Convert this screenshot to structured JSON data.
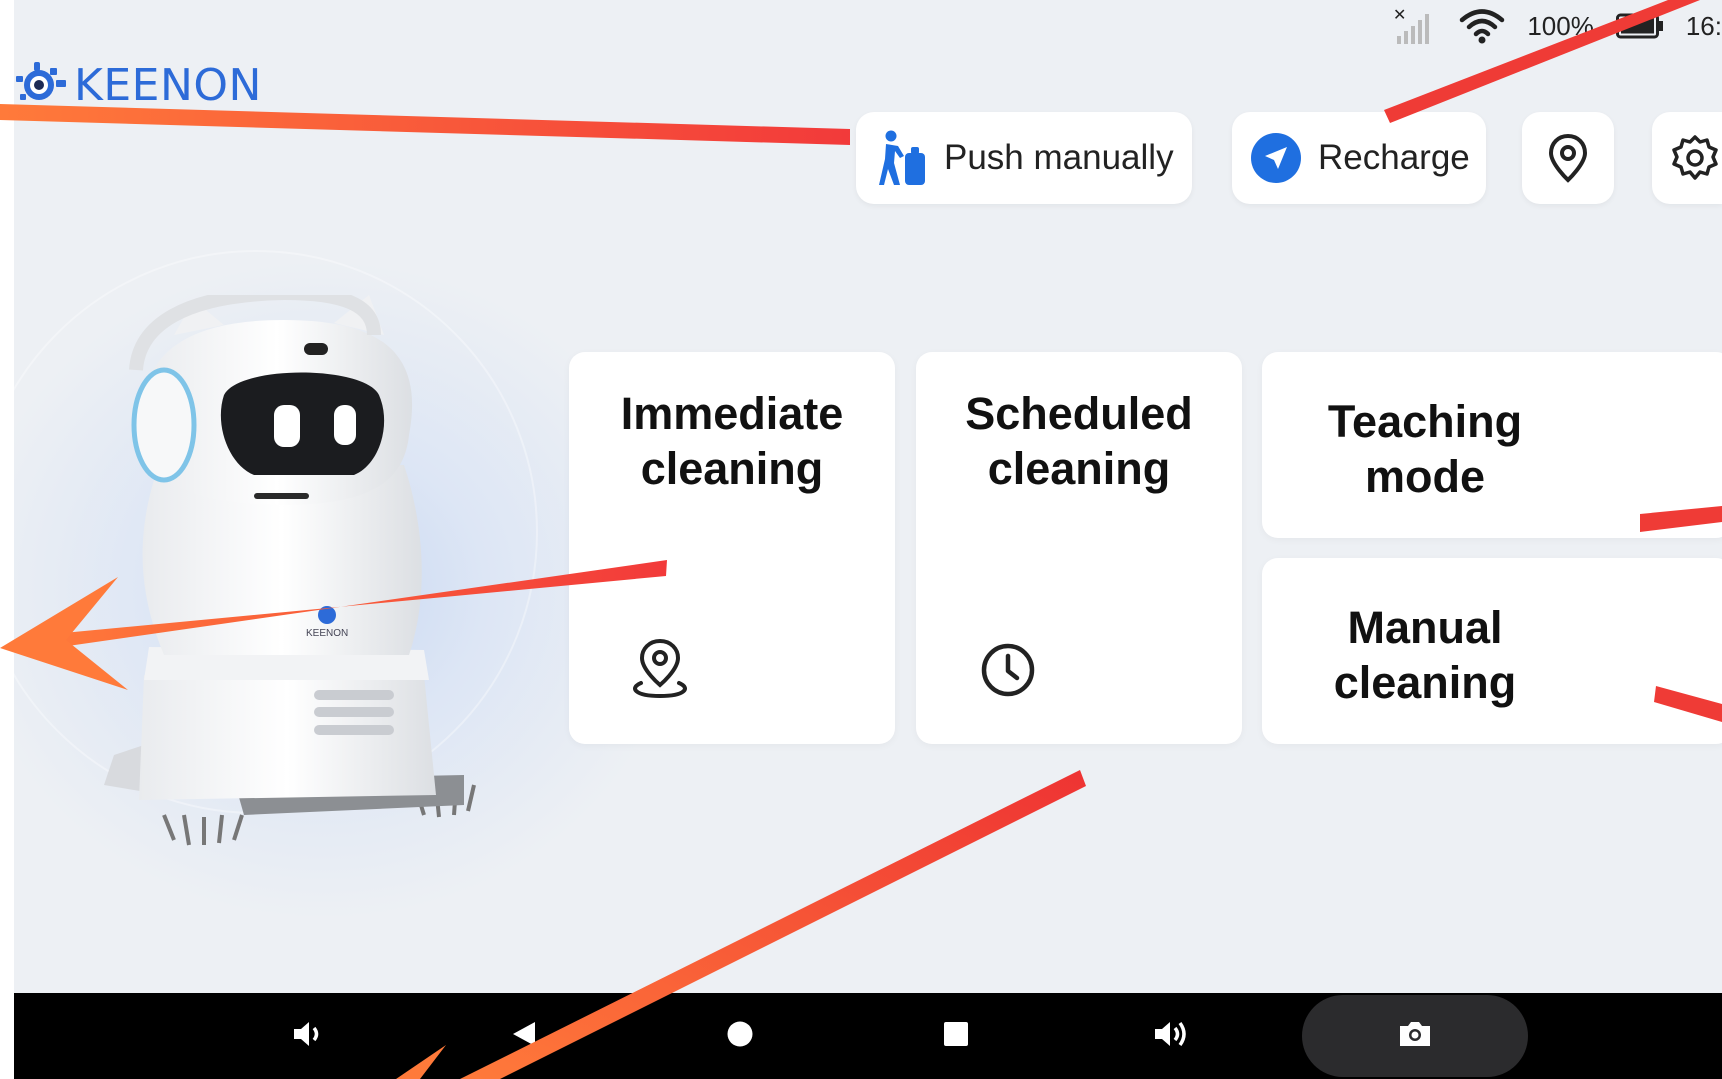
{
  "status_bar": {
    "battery_text": "100%",
    "time_text": "16:"
  },
  "logo": {
    "text": "KEENON"
  },
  "toolbar": {
    "push_manually_label": "Push manually",
    "recharge_label": "Recharge"
  },
  "robot": {
    "brand_text": "KEENON"
  },
  "cards": {
    "immediate": {
      "title": "Immediate\ncleaning"
    },
    "scheduled": {
      "title": "Scheduled\ncleaning"
    },
    "teaching": {
      "title": "Teaching\nmode"
    },
    "manual": {
      "title": "Manual\ncleaning"
    }
  },
  "colors": {
    "accent": "#2d6bd8",
    "recharge_icon": "#1f6fe0",
    "push_icon": "#1f6fe0",
    "annotation_arrow": "#f04a3a",
    "navbar": "#000000"
  },
  "icons": {
    "status": [
      "no-signal-icon",
      "wifi-icon",
      "battery-icon"
    ],
    "toolbar": [
      "push-person-icon",
      "navigation-arrow-icon",
      "location-pin-icon",
      "gear-icon"
    ],
    "cards": [
      "location-pin-icon",
      "clock-icon"
    ],
    "navbar": [
      "volume-down-icon",
      "back-icon",
      "home-icon",
      "recents-icon",
      "volume-up-icon",
      "camera-icon"
    ]
  }
}
